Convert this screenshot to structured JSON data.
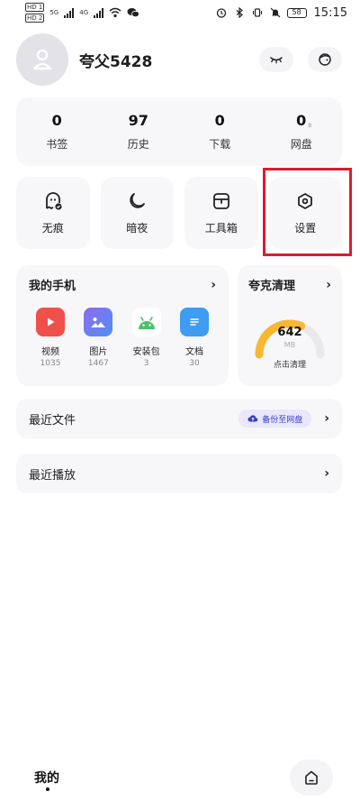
{
  "status_bar": {
    "sim1": "HD 1",
    "sim2": "HD 2",
    "net1": "5G",
    "net2": "4G",
    "battery": "58",
    "time": "15:15"
  },
  "profile": {
    "username": "夸父5428"
  },
  "stats": [
    {
      "value": "0",
      "label": "书签"
    },
    {
      "value": "97",
      "label": "历史"
    },
    {
      "value": "0",
      "label": "下载"
    },
    {
      "value": "0",
      "label": "网盘",
      "sub": "B"
    }
  ],
  "tools": [
    {
      "label": "无痕",
      "icon": "ghost-icon"
    },
    {
      "label": "暗夜",
      "icon": "moon-icon"
    },
    {
      "label": "工具箱",
      "icon": "toolbox-icon"
    },
    {
      "label": "设置",
      "icon": "settings-icon"
    }
  ],
  "phone": {
    "title": "我的手机",
    "items": [
      {
        "label": "视频",
        "count": "1035",
        "icon": "video-icon",
        "color": "#f0504a"
      },
      {
        "label": "图片",
        "count": "1467",
        "icon": "image-icon",
        "color": "#6b7bf0"
      },
      {
        "label": "安装包",
        "count": "3",
        "icon": "android-icon",
        "color": "#4cc06b"
      },
      {
        "label": "文档",
        "count": "30",
        "icon": "document-icon",
        "color": "#3e9cf2"
      }
    ]
  },
  "clean": {
    "title": "夸克清理",
    "value": "642",
    "unit": "MB",
    "action": "点击清理",
    "gauge_fraction": 0.62
  },
  "recent_files": {
    "title": "最近文件",
    "backup_label": "备份至网盘"
  },
  "recent_play": {
    "title": "最近播放"
  },
  "bottom_nav": {
    "title": "我的"
  },
  "colors": {
    "highlight": "#e3182d",
    "gauge": "#f7b731",
    "card_bg": "#f7f7f9"
  }
}
